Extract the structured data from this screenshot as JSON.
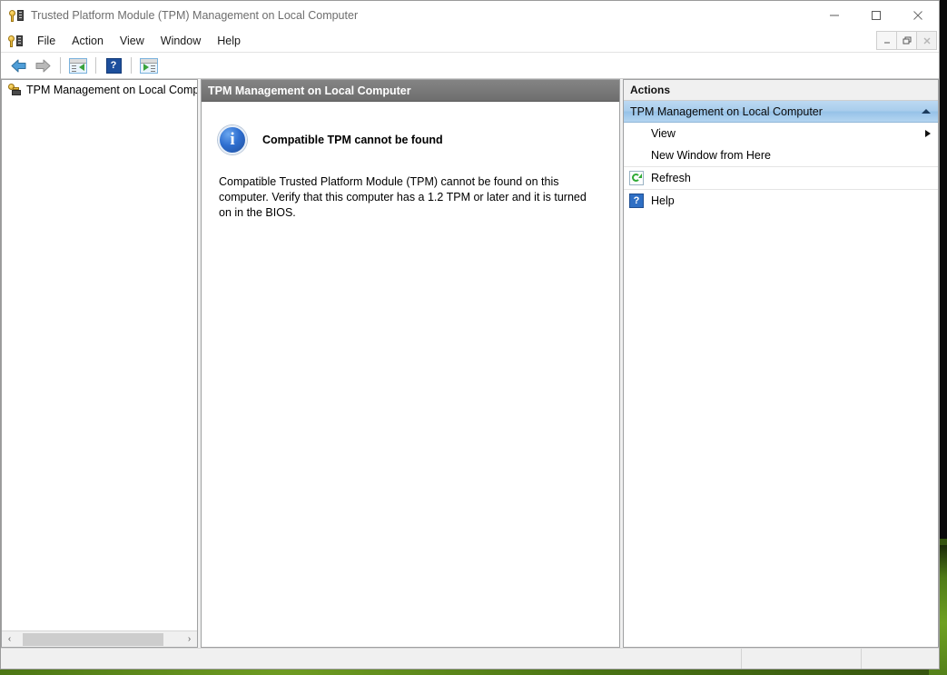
{
  "window": {
    "title": "Trusted Platform Module (TPM) Management on Local Computer",
    "app_icon": "tpm-key-icon",
    "controls": {
      "minimize": "minimize-icon",
      "maximize": "maximize-icon",
      "close": "close-icon"
    },
    "mdi_controls": {
      "minimize": "–",
      "restore": "restore-icon",
      "close": "close-icon"
    }
  },
  "menubar": {
    "items": [
      {
        "label": "File"
      },
      {
        "label": "Action"
      },
      {
        "label": "View"
      },
      {
        "label": "Window"
      },
      {
        "label": "Help"
      }
    ]
  },
  "toolbar": {
    "buttons": [
      {
        "name": "back-button",
        "icon": "back-arrow-icon"
      },
      {
        "name": "forward-button",
        "icon": "forward-arrow-icon"
      },
      {
        "name": "show-hide-tree-button",
        "icon": "show-console-tree-icon"
      },
      {
        "name": "help-button",
        "icon": "help-question-icon",
        "glyph": "?"
      },
      {
        "name": "show-hide-action-pane-button",
        "icon": "show-action-pane-icon"
      }
    ]
  },
  "tree": {
    "items": [
      {
        "label": "TPM Management on Local Comp",
        "icon": "tpm-key-icon"
      }
    ],
    "scrollbar": {
      "left_arrow": "‹",
      "right_arrow": "›"
    }
  },
  "center": {
    "header": "TPM Management on Local Computer",
    "status_icon": "info-icon",
    "message_title": "Compatible TPM cannot be found",
    "message_body": "Compatible Trusted Platform Module (TPM) cannot be found on this computer. Verify that this computer has a 1.2 TPM or later and it is turned on in the BIOS."
  },
  "actions": {
    "header": "Actions",
    "group_label": "TPM Management on Local Computer",
    "group_collapse_icon": "chevron-up-icon",
    "items": [
      {
        "label": "View",
        "icon": "none",
        "has_submenu": true
      },
      {
        "label": "New Window from Here",
        "icon": "none",
        "has_submenu": false
      },
      {
        "label": "Refresh",
        "icon": "refresh-icon",
        "has_submenu": false
      },
      {
        "label": "Help",
        "icon": "help-icon",
        "glyph": "?",
        "has_submenu": false
      }
    ]
  },
  "statusbar": {
    "main": "",
    "segment2": "",
    "segment3": ""
  },
  "colors": {
    "accent_header": "#6e6e6e",
    "group_highlight": "#a9cdec",
    "info_blue": "#2f6fd0",
    "refresh_green": "#2faa35",
    "help_blue": "#2f6fc4",
    "desktop_green": "#4f7b17"
  }
}
